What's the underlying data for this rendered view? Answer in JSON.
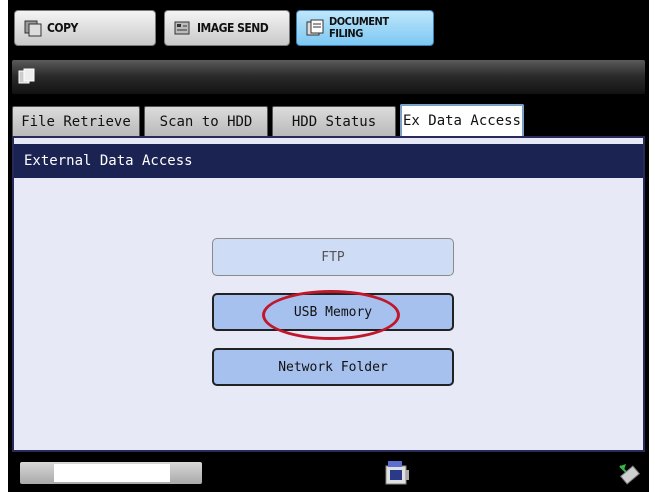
{
  "modes": {
    "copy": "COPY",
    "image_send": "IMAGE SEND",
    "document_filing_line1": "DOCUMENT",
    "document_filing_line2": "FILING"
  },
  "tabs": [
    {
      "label": "File Retrieve",
      "active": false
    },
    {
      "label": "Scan to HDD",
      "active": false
    },
    {
      "label": "HDD Status",
      "active": false
    },
    {
      "label": "Ex Data Access",
      "active": true
    }
  ],
  "panel": {
    "header": "External Data Access",
    "options": [
      {
        "label": "FTP",
        "enabled": false
      },
      {
        "label": "USB Memory",
        "enabled": true,
        "highlighted": true
      },
      {
        "label": "Network Folder",
        "enabled": true
      }
    ]
  },
  "colors": {
    "header_bg": "#1b2352",
    "option_bg": "#a7c1ee",
    "active_mode": "#7cc8f2",
    "highlight_ring": "#c0172b"
  },
  "icons": [
    "copy-icon",
    "image-send-icon",
    "document-filing-icon",
    "document-title-icon",
    "machine-status-icon",
    "tool-icon"
  ]
}
